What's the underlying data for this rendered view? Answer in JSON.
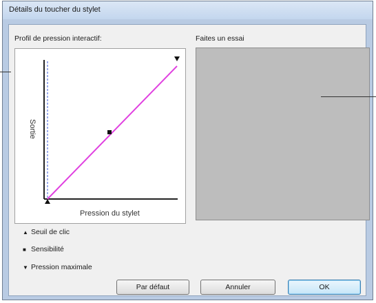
{
  "window": {
    "title": "Détails du toucher du stylet"
  },
  "graph": {
    "section_label": "Profil de pression interactif:",
    "ylabel": "Sortie",
    "xlabel": "Pression du stylet"
  },
  "test_area": {
    "section_label": "Faites un essai"
  },
  "legend": {
    "click_threshold": {
      "symbol": "▲",
      "label": "Seuil de clic"
    },
    "sensitivity": {
      "symbol": "■",
      "label": "Sensibilité"
    },
    "max_pressure": {
      "symbol": "▼",
      "label": "Pression maximale"
    }
  },
  "buttons": {
    "default_label": "Par défaut",
    "cancel_label": "Annuler",
    "ok_label": "OK"
  },
  "colors": {
    "curve": "#e040e0",
    "threshold_line": "#3b5bdb",
    "test_area": "#bdbdbd"
  }
}
